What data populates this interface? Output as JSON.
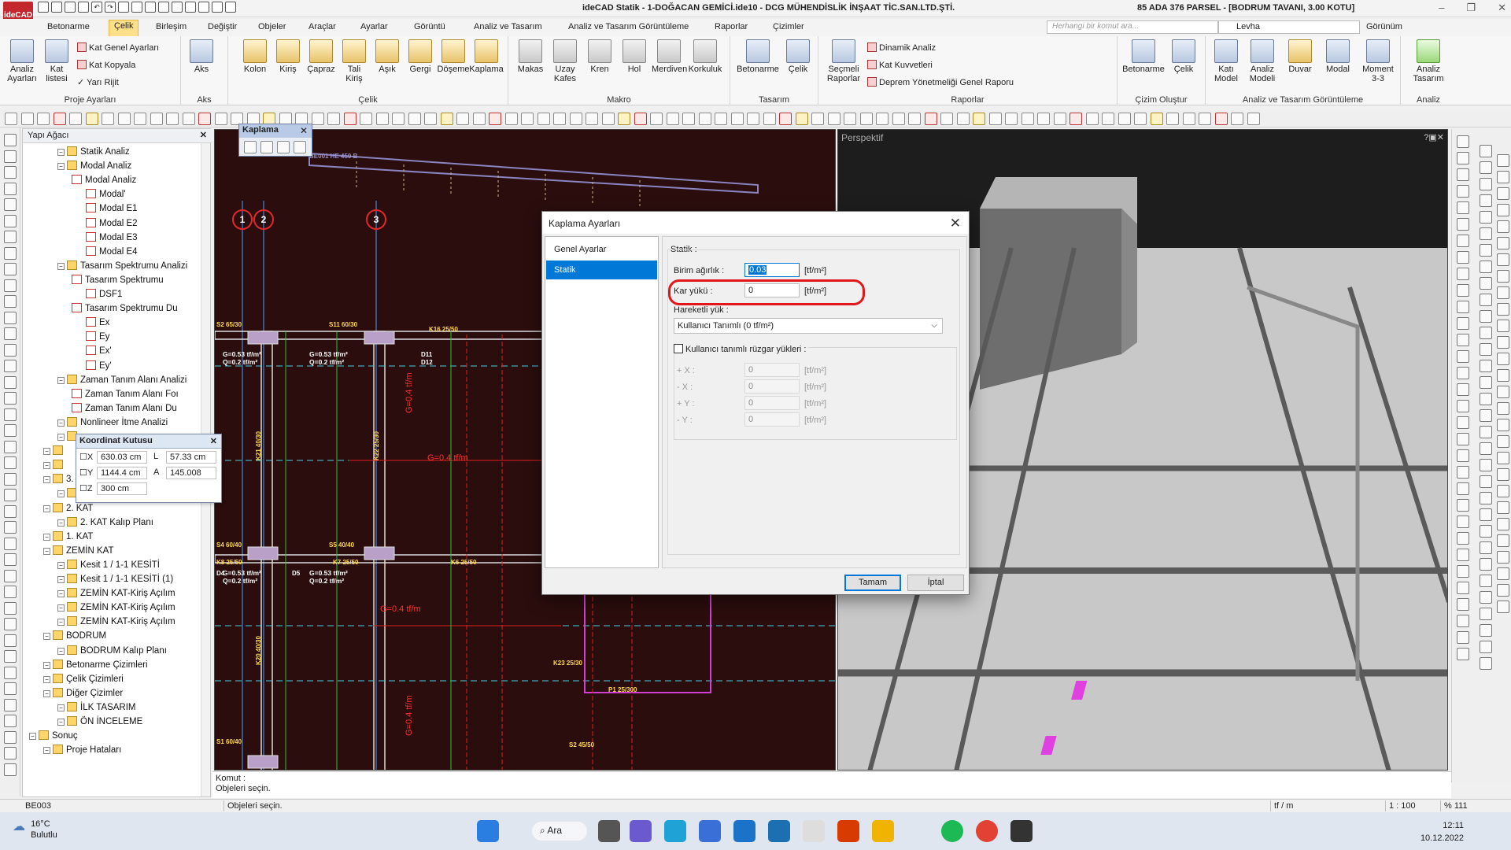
{
  "app": {
    "logo": "ideCAD",
    "title": "ideCAD Statik - 1-DOĞACAN GEMİCİ.ide10 - DCG MÜHENDİSLİK İNŞAAT TİC.SAN.LTD.ŞTİ.",
    "title_right": "85 ADA 376 PARSEL - [BODRUM TAVANI, 3.00 KOTU]"
  },
  "menu": {
    "tabs": [
      "Betonarme",
      "Çelik",
      "Birleşim",
      "Değiştir",
      "Objeler",
      "Araçlar",
      "Ayarlar",
      "Görüntü",
      "Analiz ve Tasarım",
      "Analiz ve Tasarım Görüntüleme",
      "Raporlar",
      "Çizimler"
    ],
    "active": "Çelik",
    "search_placeholder": "Herhangi bir komut ara...",
    "sheet": "Levha",
    "view": "Görünüm"
  },
  "ribbon": {
    "proje": {
      "label": "Proje Ayarları",
      "analiz": "Analiz\nAyarları",
      "kat": "Kat\nlistesi",
      "kat_genel": "Kat Genel Ayarları",
      "kat_kopyala": "Kat Kopyala",
      "yari_rijit": "Yarı Rijit"
    },
    "aks": {
      "label": "Aks",
      "aks": "Aks"
    },
    "celik": {
      "label": "Çelik",
      "items": [
        "Kolon",
        "Kiriş",
        "Çapraz",
        "Tali\nKiriş",
        "Aşık",
        "Gergi",
        "Döşeme",
        "Kaplama"
      ]
    },
    "makro": {
      "label": "Makro",
      "items": [
        "Makas",
        "Uzay\nKafes",
        "Kren",
        "Hol",
        "Merdiven",
        "Korkuluk"
      ]
    },
    "tasarim": {
      "label": "Tasarım",
      "items": [
        "Betonarme",
        "Çelik"
      ]
    },
    "raporlar": {
      "label": "Raporlar",
      "secmeli": "Seçmeli\nRaporlar",
      "dinamik": "Dinamik Analiz",
      "kat_kuvvetleri": "Kat Kuvvetleri",
      "deprem": "Deprem Yönetmeliği Genel Raporu"
    },
    "cizim_olustur": {
      "label": "Çizim Oluştur",
      "items": [
        "Betonarme",
        "Çelik"
      ]
    },
    "analiz_goruntuleme": {
      "label": "Analiz ve Tasarım Görüntüleme",
      "items": [
        "Katı\nModel",
        "Analiz\nModeli",
        "Duvar",
        "Modal",
        "Moment\n3-3"
      ]
    },
    "analiz": {
      "label": "Analiz",
      "item": "Analiz\nTasarım"
    }
  },
  "tree": {
    "title": "Yapı Ağacı",
    "nodes": [
      {
        "label": "Statik Analiz",
        "depth": 2
      },
      {
        "label": "Modal Analiz",
        "depth": 2
      },
      {
        "label": "Modal Analiz",
        "depth": 3
      },
      {
        "label": "Modal'",
        "depth": 4
      },
      {
        "label": "Modal E1",
        "depth": 4
      },
      {
        "label": "Modal E2",
        "depth": 4
      },
      {
        "label": "Modal E3",
        "depth": 4
      },
      {
        "label": "Modal E4",
        "depth": 4
      },
      {
        "label": "Tasarım Spektrumu Analizi",
        "depth": 2
      },
      {
        "label": "Tasarım Spektrumu",
        "depth": 3
      },
      {
        "label": "DSF1",
        "depth": 4
      },
      {
        "label": "Tasarım Spektrumu Du",
        "depth": 3
      },
      {
        "label": "Ex",
        "depth": 4
      },
      {
        "label": "Ey",
        "depth": 4
      },
      {
        "label": "Ex'",
        "depth": 4
      },
      {
        "label": "Ey'",
        "depth": 4
      },
      {
        "label": "Zaman Tanım Alanı Analizi",
        "depth": 2
      },
      {
        "label": "Zaman Tanım Alanı Foı",
        "depth": 3
      },
      {
        "label": "Zaman Tanım Alanı Du",
        "depth": 3
      },
      {
        "label": "Nonlineer İtme Analizi",
        "depth": 2
      },
      {
        "label": "",
        "depth": 2
      },
      {
        "label": "",
        "depth": 1
      },
      {
        "label": "",
        "depth": 1
      },
      {
        "label": "3. KAT",
        "depth": 1
      },
      {
        "label": "3. KAT Kalıp Planı",
        "depth": 2
      },
      {
        "label": "2. KAT",
        "depth": 1
      },
      {
        "label": "2. KAT Kalıp Planı",
        "depth": 2
      },
      {
        "label": "1. KAT",
        "depth": 1
      },
      {
        "label": "ZEMİN KAT",
        "depth": 1
      },
      {
        "label": "Kesit 1 / 1-1 KESİTİ",
        "depth": 2
      },
      {
        "label": "Kesit 1 / 1-1 KESİTİ (1)",
        "depth": 2
      },
      {
        "label": "ZEMİN KAT-Kiriş Açılım",
        "depth": 2
      },
      {
        "label": "ZEMİN KAT-Kiriş Açılım",
        "depth": 2
      },
      {
        "label": "ZEMİN KAT-Kiriş Açılım",
        "depth": 2
      },
      {
        "label": "BODRUM",
        "depth": 1
      },
      {
        "label": "BODRUM Kalıp Planı",
        "depth": 2
      },
      {
        "label": "Betonarme Çizimleri",
        "depth": 1
      },
      {
        "label": "Çelik Çizimleri",
        "depth": 1
      },
      {
        "label": "Diğer Çizimler",
        "depth": 1
      },
      {
        "label": "İLK TASARIM",
        "depth": 2
      },
      {
        "label": "ÖN İNCELEME",
        "depth": 2
      },
      {
        "label": "Sonuç",
        "depth": 0
      },
      {
        "label": "Proje Hataları",
        "depth": 1
      }
    ]
  },
  "coord": {
    "title": "Koordinat Kutusu",
    "x": "630.03 cm",
    "l_label": "L",
    "l": "57.33 cm",
    "y": "1144.4 cm",
    "a_label": "A",
    "a": "145.008",
    "z": "300 cm"
  },
  "kaplama_toolbar": {
    "title": "Kaplama"
  },
  "cad": {
    "axes": [
      "1",
      "2",
      "3"
    ],
    "labels": [
      "BE001 HE 450 B",
      "S2 65/30",
      "S11 60/30",
      "K16 25/50",
      "K21 40/30",
      "K22 25/30",
      "S4 60/40",
      "S5 40/40",
      "K8 25/50",
      "K7 25/50",
      "K6 25/50",
      "K20 40/30",
      "P1 25/300",
      "S2 45/50",
      "S1 60/40",
      "K23 25/30"
    ],
    "slab_loads": [
      "G=0.53 tf/m²",
      "Q=0.2 tf/m²",
      "G=0.53 tf/m²",
      "Q=0.2 tf/m²",
      "G=0.53 tf/m²",
      "Q=0.2 tf/m²",
      "G=0.53 tf/m²",
      "Q=0.2 tf/m²"
    ],
    "slab_ids": [
      "D4",
      "D5",
      "D11",
      "D12"
    ],
    "line_loads": [
      "G=0.4 tf/m",
      "G=0.4 tf/m",
      "G=0.4 tf/m",
      "G=0.4 tf/m"
    ]
  },
  "view3d": {
    "title": "Perspektif"
  },
  "dialog": {
    "title": "Kaplama Ayarları",
    "nav": [
      "Genel Ayarlar",
      "Statik"
    ],
    "nav_selected": "Statik",
    "section": "Statik :",
    "birim_agirlik_label": "Birim ağırlık :",
    "birim_agirlik": "0.03",
    "unit": "[tf/m²]",
    "kar_yuku_label": "Kar yükü :",
    "kar_yuku": "0",
    "hareketli_label": "Hareketli yük :",
    "hareketli_value": "Kullanıcı Tanımlı (0 tf/m²)",
    "ruzgar_label": "Kullanıcı tanımlı rüzgar yükleri :",
    "ruzgar": [
      {
        "label": "+ X :",
        "value": "0"
      },
      {
        "label": "- X :",
        "value": "0"
      },
      {
        "label": "+ Y :",
        "value": "0"
      },
      {
        "label": "- Y :",
        "value": "0"
      }
    ],
    "ok": "Tamam",
    "cancel": "İptal"
  },
  "command": {
    "label": "Komut :",
    "text": "Objeleri seçin."
  },
  "status": {
    "left": "BE003",
    "msg": "Objeleri seçin.",
    "unit": "tf / m",
    "scale": "1 : 100",
    "zoom": "% 111"
  },
  "taskbar": {
    "temp": "16°C",
    "weather": "Bulutlu",
    "search": "Ara",
    "time": "12:11",
    "date": "10.12.2022"
  },
  "colors": {
    "cad_bg": "#2b0d0d",
    "accent": "#0078d7",
    "highlight": "#e0181e",
    "tab_active": "#ffe08a"
  }
}
